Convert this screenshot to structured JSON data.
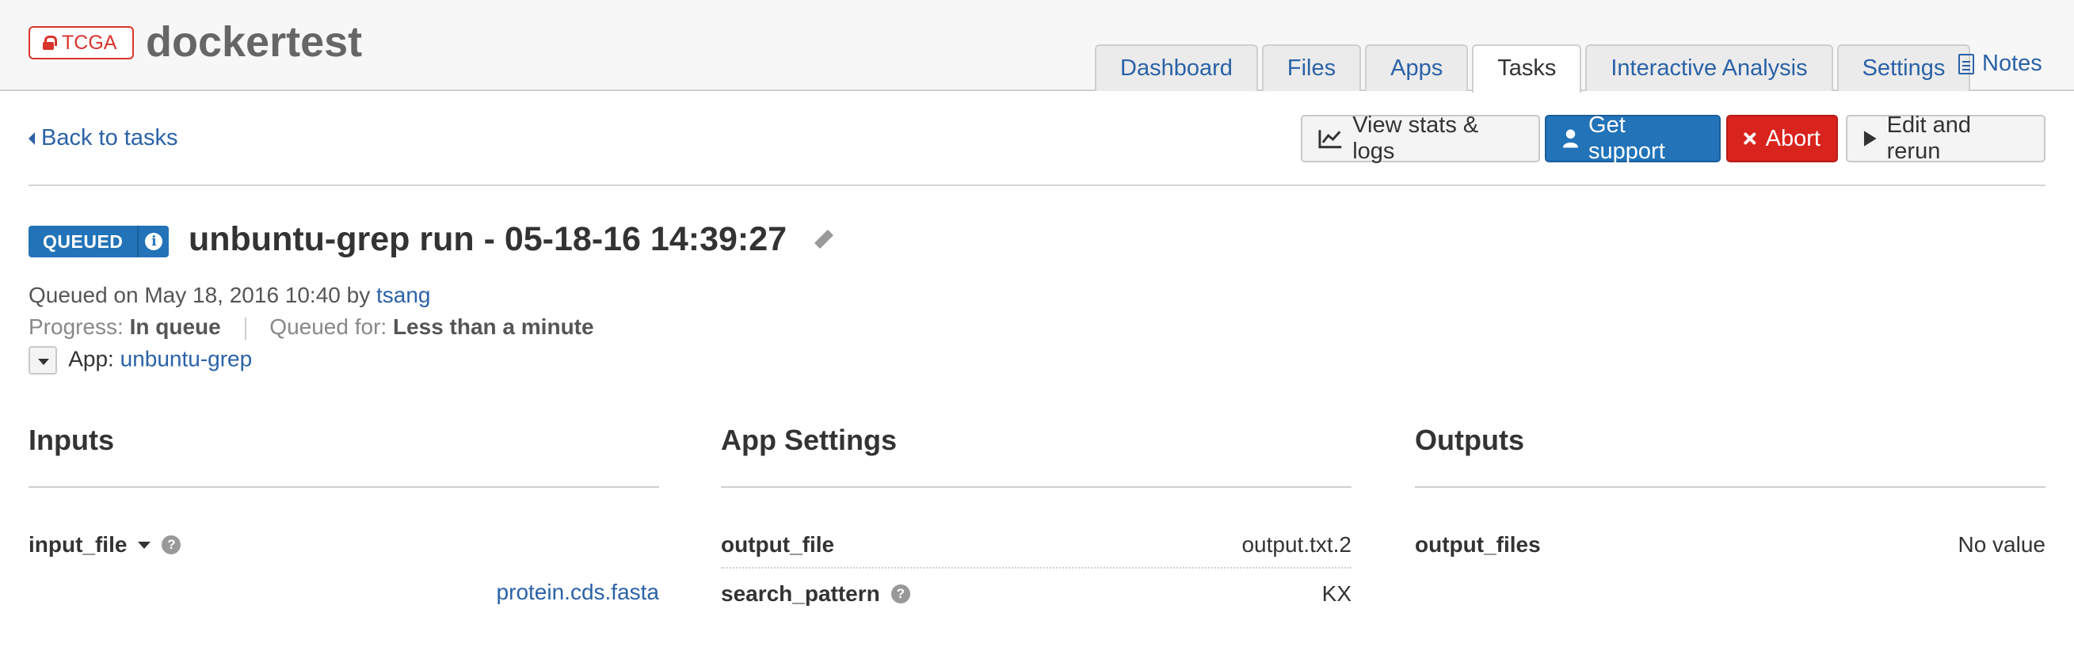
{
  "header": {
    "badge_label": "TCGA",
    "project_title": "dockertest",
    "tabs": [
      {
        "label": "Dashboard"
      },
      {
        "label": "Files"
      },
      {
        "label": "Apps"
      },
      {
        "label": "Tasks",
        "active": true
      },
      {
        "label": "Interactive Analysis"
      },
      {
        "label": "Settings"
      }
    ],
    "notes_label": "Notes"
  },
  "toolbar": {
    "back_label": "Back to tasks",
    "view_stats_label": "View stats & logs",
    "get_support_label": "Get support",
    "abort_label": "Abort",
    "edit_rerun_label": "Edit and rerun"
  },
  "task": {
    "status": "QUEUED",
    "title": "unbuntu-grep run - 05-18-16 14:39:27",
    "queued_on_prefix": "Queued on May 18, 2016 10:40 by",
    "user": "tsang",
    "progress_label": "Progress:",
    "progress_value": "In queue",
    "queued_for_label": "Queued for:",
    "queued_for_value": "Less than a minute",
    "app_label": "App:",
    "app_name": "unbuntu-grep"
  },
  "inputs": {
    "title": "Inputs",
    "fields": [
      {
        "name": "input_file",
        "value": "protein.cds.fasta"
      }
    ]
  },
  "app_settings": {
    "title": "App Settings",
    "fields": [
      {
        "name": "output_file",
        "value": "output.txt.2"
      },
      {
        "name": "search_pattern",
        "value": "KX"
      }
    ]
  },
  "outputs": {
    "title": "Outputs",
    "fields": [
      {
        "name": "output_files",
        "value": "No value"
      }
    ]
  },
  "colors": {
    "primary": "#2273b8",
    "danger": "#d9231d",
    "link": "#2a62a7"
  }
}
